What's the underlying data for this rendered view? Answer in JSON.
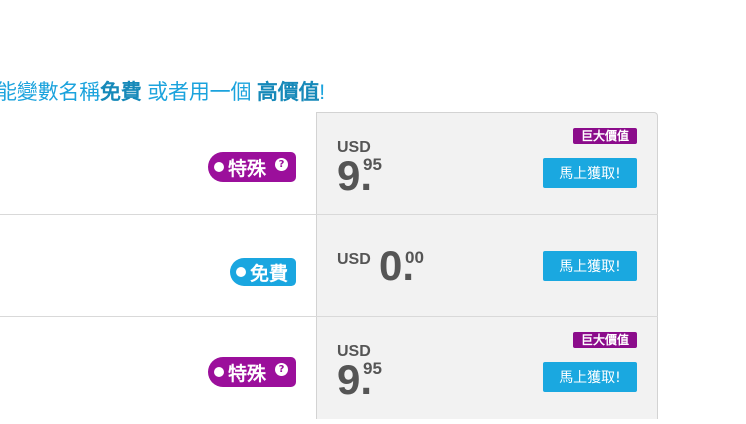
{
  "heading": {
    "prefix": "能變數名稱",
    "free_word": "免費",
    "middle": " 或者用一個 ",
    "value_word": "高價值",
    "suffix": "!"
  },
  "rows": [
    {
      "tag_label": "特殊",
      "tag_type": "special",
      "currency": "USD",
      "price_int": "9.",
      "price_dec": "95",
      "badge": "巨大價值",
      "button_label": "馬上獲取!"
    },
    {
      "tag_label": "免費",
      "tag_type": "free",
      "currency": "USD",
      "price_int": "0.",
      "price_dec": "00",
      "badge": "",
      "button_label": "馬上獲取!"
    },
    {
      "tag_label": "特殊",
      "tag_type": "special",
      "currency": "USD",
      "price_int": "9.",
      "price_dec": "95",
      "badge": "巨大價值",
      "button_label": "馬上獲取!"
    }
  ],
  "colors": {
    "accent_blue": "#1aa8e0",
    "special_purple": "#9b0f9b",
    "cell_gray": "#f2f2f2"
  }
}
